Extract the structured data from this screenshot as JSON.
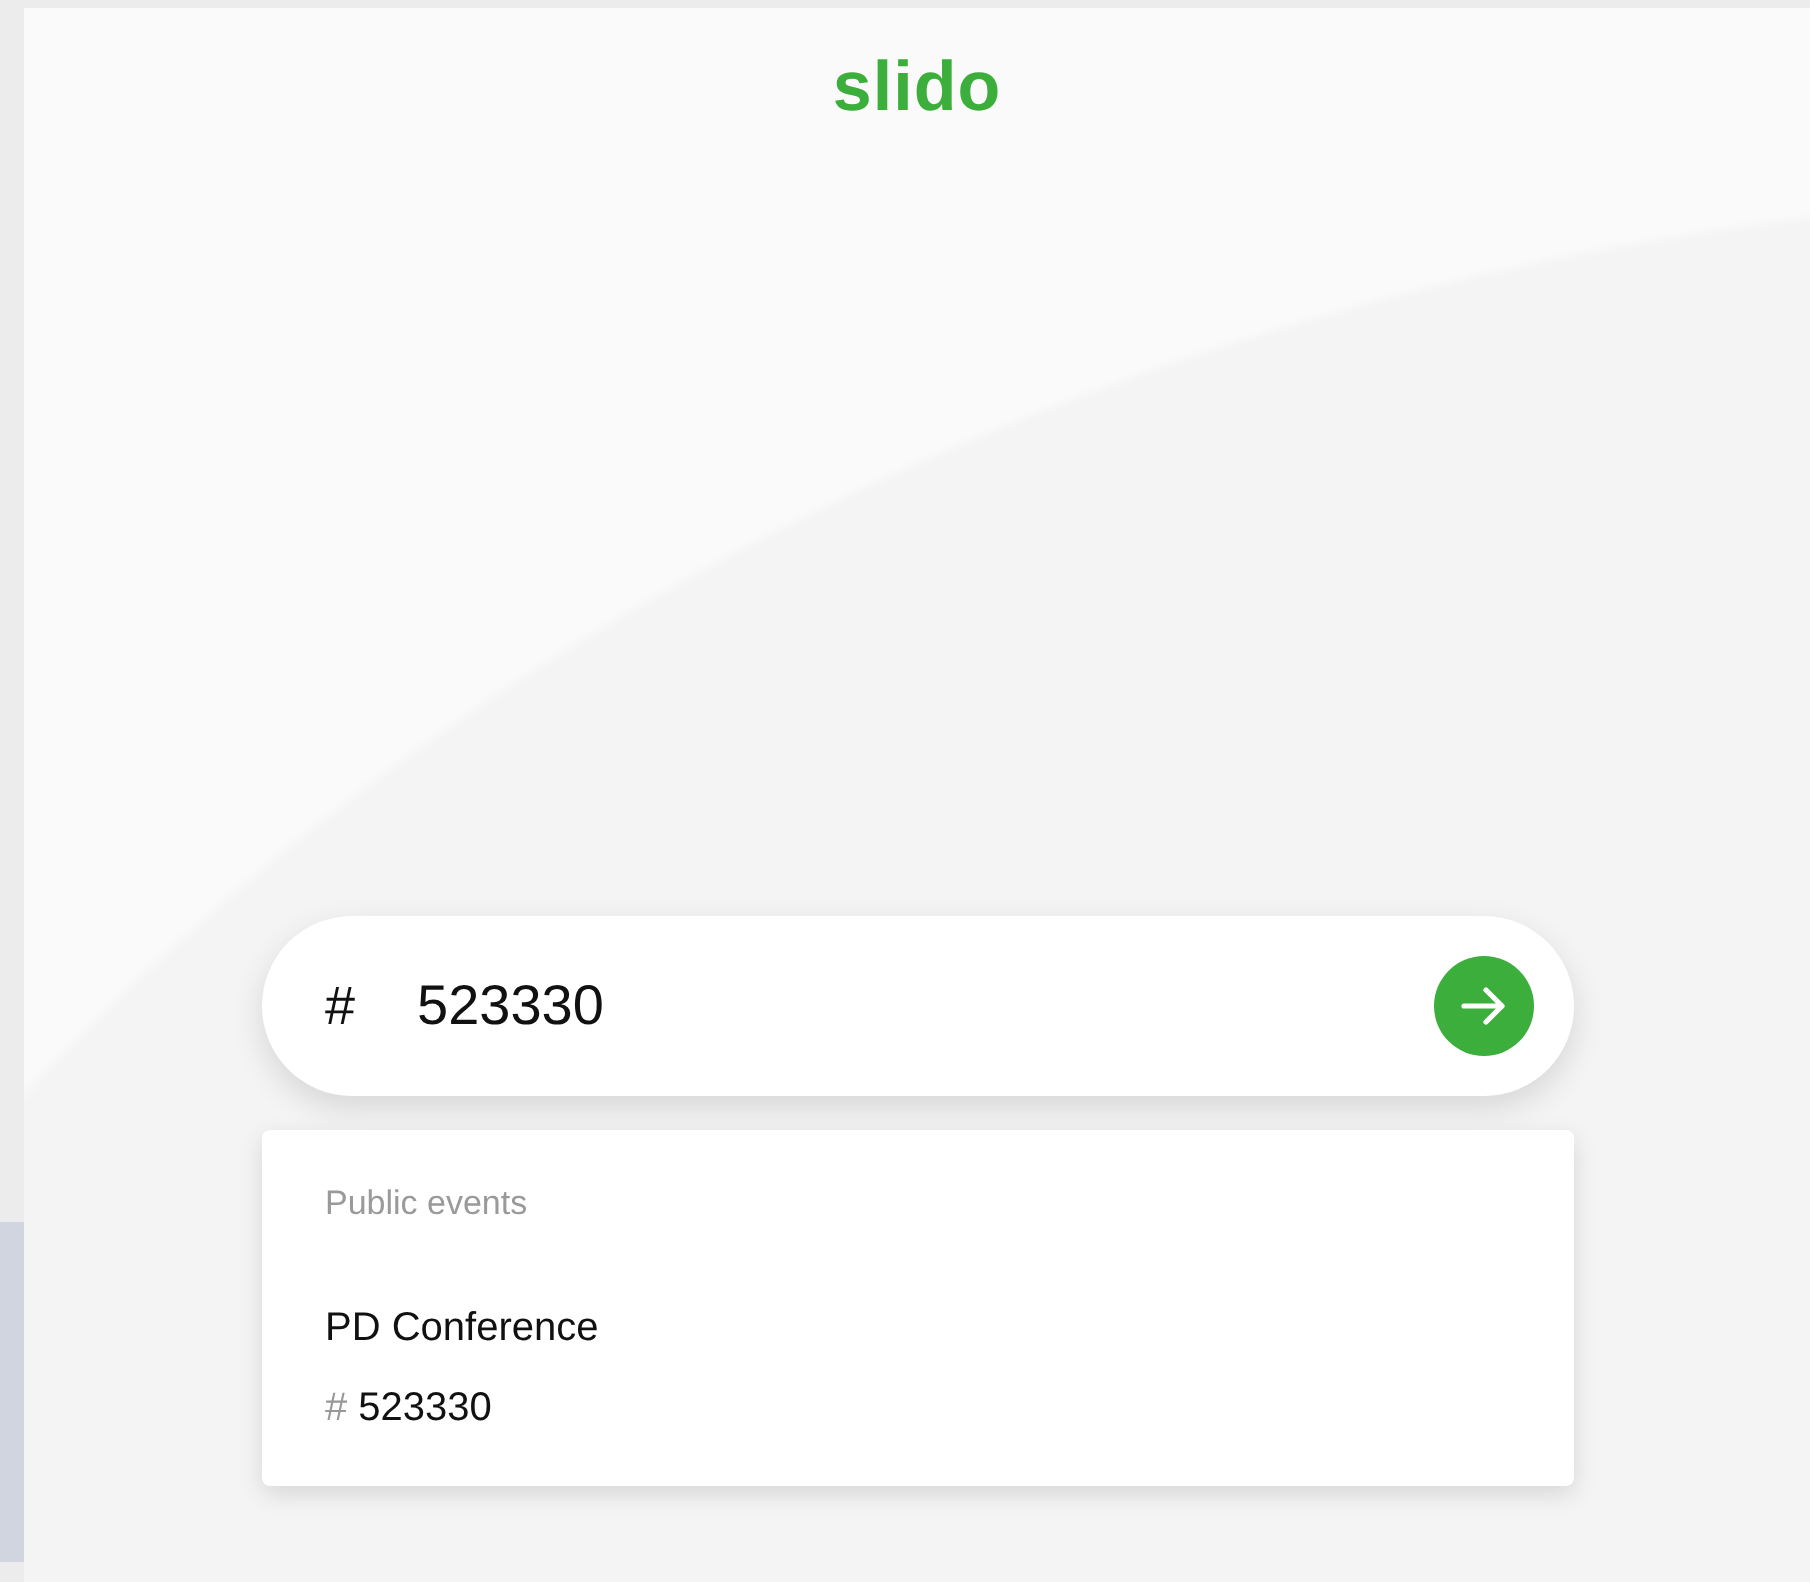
{
  "logo": {
    "text": "slido"
  },
  "search": {
    "prefix": "#",
    "value": "523330"
  },
  "dropdown": {
    "heading": "Public events",
    "events": [
      {
        "name": "PD Conference",
        "code_prefix": "#",
        "code": "523330"
      }
    ]
  }
}
